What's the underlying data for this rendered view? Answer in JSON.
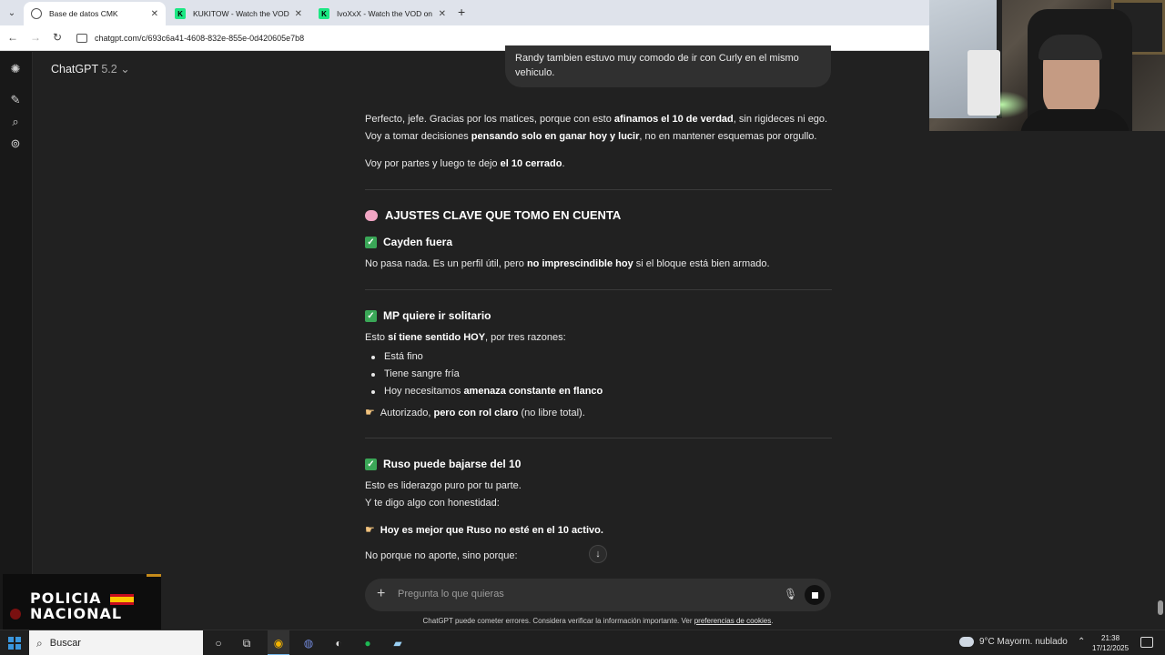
{
  "browser": {
    "tabs": [
      {
        "title": "Base de datos CMK",
        "active": true
      },
      {
        "title": "KUKITOW - Watch the VOD on",
        "active": false
      },
      {
        "title": "IvoXxX - Watch the VOD on Kic",
        "active": false
      }
    ],
    "new_tab": "+",
    "url": "chatgpt.com/c/693c6a41-4608-832e-855e-0d420605e7b8"
  },
  "app": {
    "name": "ChatGPT",
    "version": "5.2"
  },
  "user_message": {
    "line1": "Randy tambien estuvo muy comodo de ir con Curly en el mismo",
    "line2": "vehiculo."
  },
  "response": {
    "intro": {
      "p1_a": "Perfecto, jefe. Gracias por los matices, porque con esto ",
      "p1_b": "afinamos el 10 de verdad",
      "p1_c": ", sin rigideces ni ego.",
      "p2_a": "Voy a tomar decisiones ",
      "p2_b": "pensando solo en ganar hoy y lucir",
      "p2_c": ", no en mantener esquemas por orgullo.",
      "p3_a": "Voy por partes y luego te dejo ",
      "p3_b": "el 10 cerrado",
      "p3_c": "."
    },
    "section_title": "AJUSTES CLAVE QUE TOMO EN CUENTA",
    "cayden": {
      "title": "Cayden fuera",
      "text_a": "No pasa nada. Es un perfil útil, pero ",
      "text_b": "no imprescindible hoy",
      "text_c": " si el bloque está bien armado."
    },
    "mp": {
      "title": "MP quiere ir solitario",
      "lead_a": "Esto ",
      "lead_b": "sí tiene sentido HOY",
      "lead_c": ", por tres razones:",
      "bullets": [
        "Está fino",
        "Tiene sangre fría"
      ],
      "bullet3_a": "Hoy necesitamos ",
      "bullet3_b": "amenaza constante en flanco",
      "note_a": "Autorizado, ",
      "note_b": "pero con rol claro",
      "note_c": " (no libre total)."
    },
    "ruso": {
      "title": "Ruso puede bajarse del 10",
      "line1": "Esto es liderazgo puro por tu parte.",
      "line2": "Y te digo algo con honestidad:",
      "highlight": "Hoy es mejor que Ruso no esté en el 10 activo.",
      "line3": "No porque no aporte, sino porque:"
    }
  },
  "composer": {
    "placeholder": "Pregunta lo que quieras",
    "disclaimer": "ChatGPT puede cometer errores. Considera verificar la información importante. Ver ",
    "disclaimer_link": "preferencias de cookies",
    "disclaimer_end": "."
  },
  "overlay_logo": {
    "line1": "POLICIA",
    "line2": "NACIONAL"
  },
  "taskbar": {
    "search_label": "Buscar",
    "weather": "9°C  Mayorm. nublado",
    "time": "21:38",
    "date": "17/12/2025"
  },
  "colors": {
    "background": "#212121",
    "check_green": "#3aa757",
    "bubble": "#303030"
  }
}
